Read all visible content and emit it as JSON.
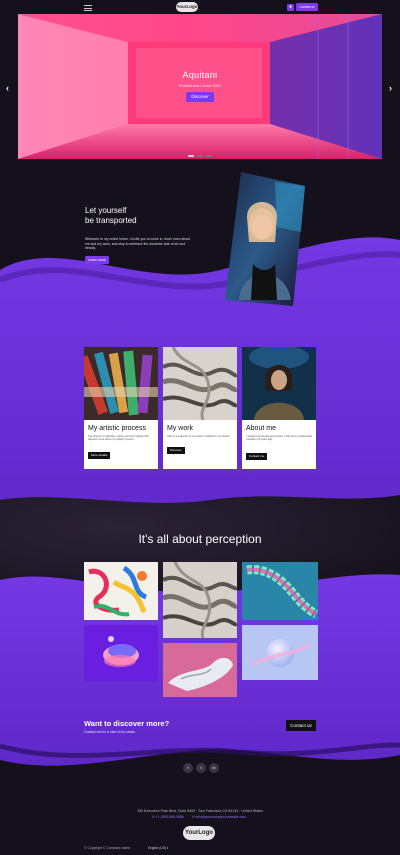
{
  "header": {
    "logo_text": "YourLogo",
    "contact_label": "Contact us",
    "menu_icon": "hamburger-icon"
  },
  "hero": {
    "title": "Aquitani",
    "subtitle": "Photoshoot / June 2021",
    "button_label": "Discover",
    "prev_arrow": "‹",
    "next_arrow": "›",
    "slide_count": 3,
    "active_slide": 1
  },
  "transport": {
    "title_line1": "Let yourself",
    "title_line2": "be transported",
    "text": "Welcome to my online home. I invite you to come in, learn more about me and my work, and stop to embrace the dreamier side of art and beauty.",
    "button_label": "Learn more"
  },
  "cards": [
    {
      "title": "My artistic process",
      "text": "The choice of materials, colours and the insights with discover more about my artistic process.",
      "button": "More details"
    },
    {
      "title": "My work",
      "text": "Here is a selection of my works, exhibited in my studio.",
      "button": "Discover"
    },
    {
      "title": "About me",
      "text": "I started a corporate accountant. It has led to professional transition 10 years ago.",
      "button": "Contact me"
    }
  ],
  "perception": {
    "title": "It's all about perception"
  },
  "discover": {
    "title": "Want to discover more?",
    "subtitle": "Contact me for a visit of my studio.",
    "button_label": "Contact us"
  },
  "footer": {
    "social": [
      "f",
      "t",
      "in"
    ],
    "address": "350 Executive Park Blvd, Suite 8400 · San Francisco CA 94134 · United States",
    "phone": "+1 (555) 555-5556",
    "email": "info@yourcompany.example.com",
    "logo_text": "YourLogo",
    "copyright": "© Copyright © Company name",
    "language": "English (US) ▾"
  },
  "colors": {
    "accent": "#7c3aed",
    "background": "#14101c",
    "purple_band": "#6a2fd6"
  }
}
